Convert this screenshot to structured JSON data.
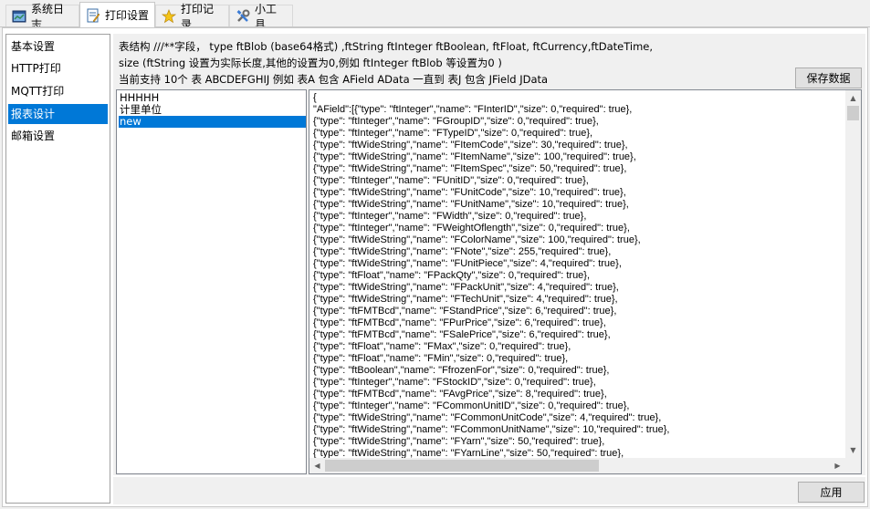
{
  "tabs": [
    {
      "label": "系统日志",
      "icon": "log-icon"
    },
    {
      "label": "打印设置",
      "icon": "print-settings-icon"
    },
    {
      "label": "打印记录",
      "icon": "star-record-icon"
    },
    {
      "label": "小工具",
      "icon": "tools-icon"
    }
  ],
  "nav": {
    "items": [
      "基本设置",
      "HTTP打印",
      "MQTT打印",
      "报表设计",
      "邮箱设置"
    ],
    "selected": "报表设计"
  },
  "description": {
    "line1": "表结构 ///**字段， type ftBlob (base64格式) ,ftString ftInteger ftBoolean, ftFloat, ftCurrency,ftDateTime,",
    "line2": "size (ftString 设置为实际长度,其他的设置为0,例如 ftInteger ftBlob 等设置为0 )",
    "line3": "当前支持 10个 表  ABCDEFGHIJ 例如 表A 包含 AField  AData  一直到  表J 包含 JField  JData"
  },
  "buttons": {
    "save": "保存数据",
    "apply": "应用"
  },
  "report_list": {
    "items": [
      "HHHHH",
      "计里单位",
      "new"
    ],
    "selected": "new"
  },
  "memo": {
    "lines": [
      "{",
      "\"AField\":[{\"type\": \"ftInteger\",\"name\": \"FInterID\",\"size\": 0,\"required\": true},",
      "{\"type\": \"ftInteger\",\"name\": \"FGroupID\",\"size\": 0,\"required\": true},",
      "{\"type\": \"ftInteger\",\"name\": \"FTypeID\",\"size\": 0,\"required\": true},",
      "{\"type\": \"ftWideString\",\"name\": \"FItemCode\",\"size\": 30,\"required\": true},",
      "{\"type\": \"ftWideString\",\"name\": \"FItemName\",\"size\": 100,\"required\": true},",
      "{\"type\": \"ftWideString\",\"name\": \"FItemSpec\",\"size\": 50,\"required\": true},",
      "{\"type\": \"ftInteger\",\"name\": \"FUnitID\",\"size\": 0,\"required\": true},",
      "{\"type\": \"ftWideString\",\"name\": \"FUnitCode\",\"size\": 10,\"required\": true},",
      "{\"type\": \"ftWideString\",\"name\": \"FUnitName\",\"size\": 10,\"required\": true},",
      "{\"type\": \"ftInteger\",\"name\": \"FWidth\",\"size\": 0,\"required\": true},",
      "{\"type\": \"ftInteger\",\"name\": \"FWeightOflength\",\"size\": 0,\"required\": true},",
      "{\"type\": \"ftWideString\",\"name\": \"FColorName\",\"size\": 100,\"required\": true},",
      "{\"type\": \"ftWideString\",\"name\": \"FNote\",\"size\": 255,\"required\": true},",
      "{\"type\": \"ftWideString\",\"name\": \"FUnitPiece\",\"size\": 4,\"required\": true},",
      "{\"type\": \"ftFloat\",\"name\": \"FPackQty\",\"size\": 0,\"required\": true},",
      "{\"type\": \"ftWideString\",\"name\": \"FPackUnit\",\"size\": 4,\"required\": true},",
      "{\"type\": \"ftWideString\",\"name\": \"FTechUnit\",\"size\": 4,\"required\": true},",
      "{\"type\": \"ftFMTBcd\",\"name\": \"FStandPrice\",\"size\": 6,\"required\": true},",
      "{\"type\": \"ftFMTBcd\",\"name\": \"FPurPrice\",\"size\": 6,\"required\": true},",
      "{\"type\": \"ftFMTBcd\",\"name\": \"FSalePrice\",\"size\": 6,\"required\": true},",
      "{\"type\": \"ftFloat\",\"name\": \"FMax\",\"size\": 0,\"required\": true},",
      "{\"type\": \"ftFloat\",\"name\": \"FMin\",\"size\": 0,\"required\": true},",
      "{\"type\": \"ftBoolean\",\"name\": \"FfrozenFor\",\"size\": 0,\"required\": true},",
      "{\"type\": \"ftInteger\",\"name\": \"FStockID\",\"size\": 0,\"required\": true},",
      "{\"type\": \"ftFMTBcd\",\"name\": \"FAvgPrice\",\"size\": 8,\"required\": true},",
      "{\"type\": \"ftInteger\",\"name\": \"FCommonUnitID\",\"size\": 0,\"required\": true},",
      "{\"type\": \"ftWideString\",\"name\": \"FCommonUnitCode\",\"size\": 4,\"required\": true},",
      "{\"type\": \"ftWideString\",\"name\": \"FCommonUnitName\",\"size\": 10,\"required\": true},",
      "{\"type\": \"ftWideString\",\"name\": \"FYarn\",\"size\": 50,\"required\": true},",
      "{\"type\": \"ftWideString\",\"name\": \"FYarnLine\",\"size\": 50,\"required\": true},"
    ]
  },
  "colors": {
    "selection": "#0078d7",
    "window_bg": "#f0f0f0"
  }
}
